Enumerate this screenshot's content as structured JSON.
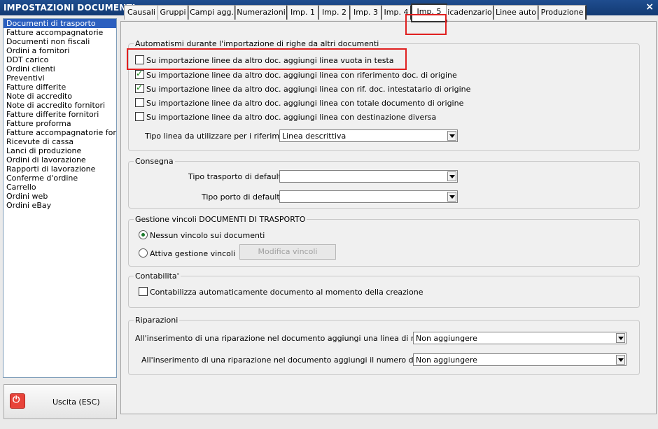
{
  "window": {
    "title": "IMPOSTAZIONI DOCUMENTI",
    "close": "×"
  },
  "doc_list": [
    "Documenti di trasporto",
    "Fatture accompagnatorie",
    "Documenti non fiscali",
    "Ordini a fornitori",
    "DDT carico",
    "Ordini clienti",
    "Preventivi",
    "Fatture differite",
    "Note di accredito",
    "Note di accredito fornitori",
    "Fatture differite fornitori",
    "Fatture proforma",
    "Fatture accompagnatorie fornito",
    "Ricevute di cassa",
    "Lanci di produzione",
    "Ordini di lavorazione",
    "Rapporti di lavorazione",
    "Conferme d'ordine",
    "Carrello",
    "Ordini web",
    "Ordini eBay"
  ],
  "exit_button": "Uscita (ESC)",
  "tabs": [
    "Causali",
    "Gruppi",
    "Campi agg.",
    "Numerazioni",
    "Imp. 1",
    "Imp. 2",
    "Imp. 3",
    "Imp. 4",
    "Imp. 5",
    "Scadenzario",
    "Linee auto",
    "Produzione"
  ],
  "tabs_visible": [
    "Causali",
    "Gruppi",
    "Campi agg.",
    "Numerazioni",
    "Imp. 1",
    "Imp. 2",
    "Imp. 3",
    "Imp. 4",
    "Imp. 5",
    "icadenzario",
    "Linee auto",
    "Produzione"
  ],
  "automatismi": {
    "legend": "Automatismi durante l'importazione di righe da altri documenti",
    "options": [
      {
        "label": "Su importazione linee da altro doc. aggiungi linea vuota in testa",
        "checked": false
      },
      {
        "label": "Su importazione linee da altro doc. aggiungi linea con riferimento doc. di origine",
        "checked": true
      },
      {
        "label": "Su importazione linee da altro doc. aggiungi linea con rif. doc. intestatario di origine",
        "checked": true
      },
      {
        "label": "Su importazione linee da altro doc. aggiungi linea con totale documento di origine",
        "checked": false
      },
      {
        "label": "Su importazione linee da altro doc. aggiungi linea con destinazione diversa",
        "checked": false
      }
    ],
    "tipo_linea_label": "Tipo linea da utilizzare per i riferimenti :",
    "tipo_linea_value": "Linea descrittiva"
  },
  "consegna": {
    "legend": "Consegna",
    "trasporto_label": "Tipo trasporto di default :",
    "trasporto_value": "",
    "porto_label": "Tipo porto di default :",
    "porto_value": ""
  },
  "vincoli": {
    "legend": "Gestione vincoli DOCUMENTI DI TRASPORTO",
    "radio_none": "Nessun vincolo sui documenti",
    "radio_active": "Attiva gestione vincoli",
    "modify_button": "Modifica vincoli"
  },
  "contabilita": {
    "legend": "Contabilita'",
    "option": "Contabilizza automaticamente documento al momento della creazione"
  },
  "riparazioni": {
    "legend": "Riparazioni",
    "line1_label": "All'inserimento di una riparazione nel documento aggiungi una linea di riferimento :",
    "line1_value": "Non aggiungere",
    "line2_label": "All'inserimento di una riparazione nel documento aggiungi il numero di matricola :",
    "line2_value": "Non aggiungere"
  }
}
